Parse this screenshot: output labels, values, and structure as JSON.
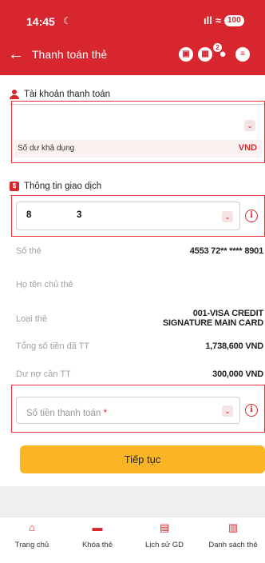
{
  "status_bar": {
    "time": "14:45",
    "dnd_glyph": "☾",
    "signal": "ıll",
    "wifi": "≈",
    "battery": "100"
  },
  "header": {
    "back_icon": "←",
    "title": "Thanh toán thẻ",
    "notification_count": "2"
  },
  "payment_account": {
    "heading": "Tài khoản thanh toán",
    "account_value": "",
    "balance_label": "Số dư khả dụng",
    "balance_currency": "VND"
  },
  "transaction_info": {
    "heading": "Thông tin giao dịch",
    "card_first": "8",
    "card_last": "3"
  },
  "details": [
    {
      "label": "Số thẻ",
      "value": "4553 72** **** 8901"
    },
    {
      "label": "Họ tên chủ thẻ",
      "value": ""
    },
    {
      "label": "Loại thẻ",
      "value_line1": "001-VISA CREDIT",
      "value_line2": "SIGNATURE MAIN CARD"
    },
    {
      "label": "Tổng số tiền đã TT",
      "value": "1,738,600 VND"
    },
    {
      "label": "Dư nợ cần TT",
      "value": "300,000 VND"
    }
  ],
  "amount_field": {
    "placeholder": "Số tiền thanh toán",
    "required_mark": "*"
  },
  "continue_button": {
    "label": "Tiếp tục"
  },
  "tab_bar": {
    "items": [
      {
        "label": "Trang chủ",
        "icon": "home-icon"
      },
      {
        "label": "Khóa thẻ",
        "icon": "lock-card-icon"
      },
      {
        "label": "Lịch sử GD",
        "icon": "history-icon"
      },
      {
        "label": "Danh sách thẻ",
        "icon": "card-list-icon"
      }
    ]
  },
  "colors": {
    "brand_red": "#d8262f",
    "button_yellow": "#f9b526"
  }
}
